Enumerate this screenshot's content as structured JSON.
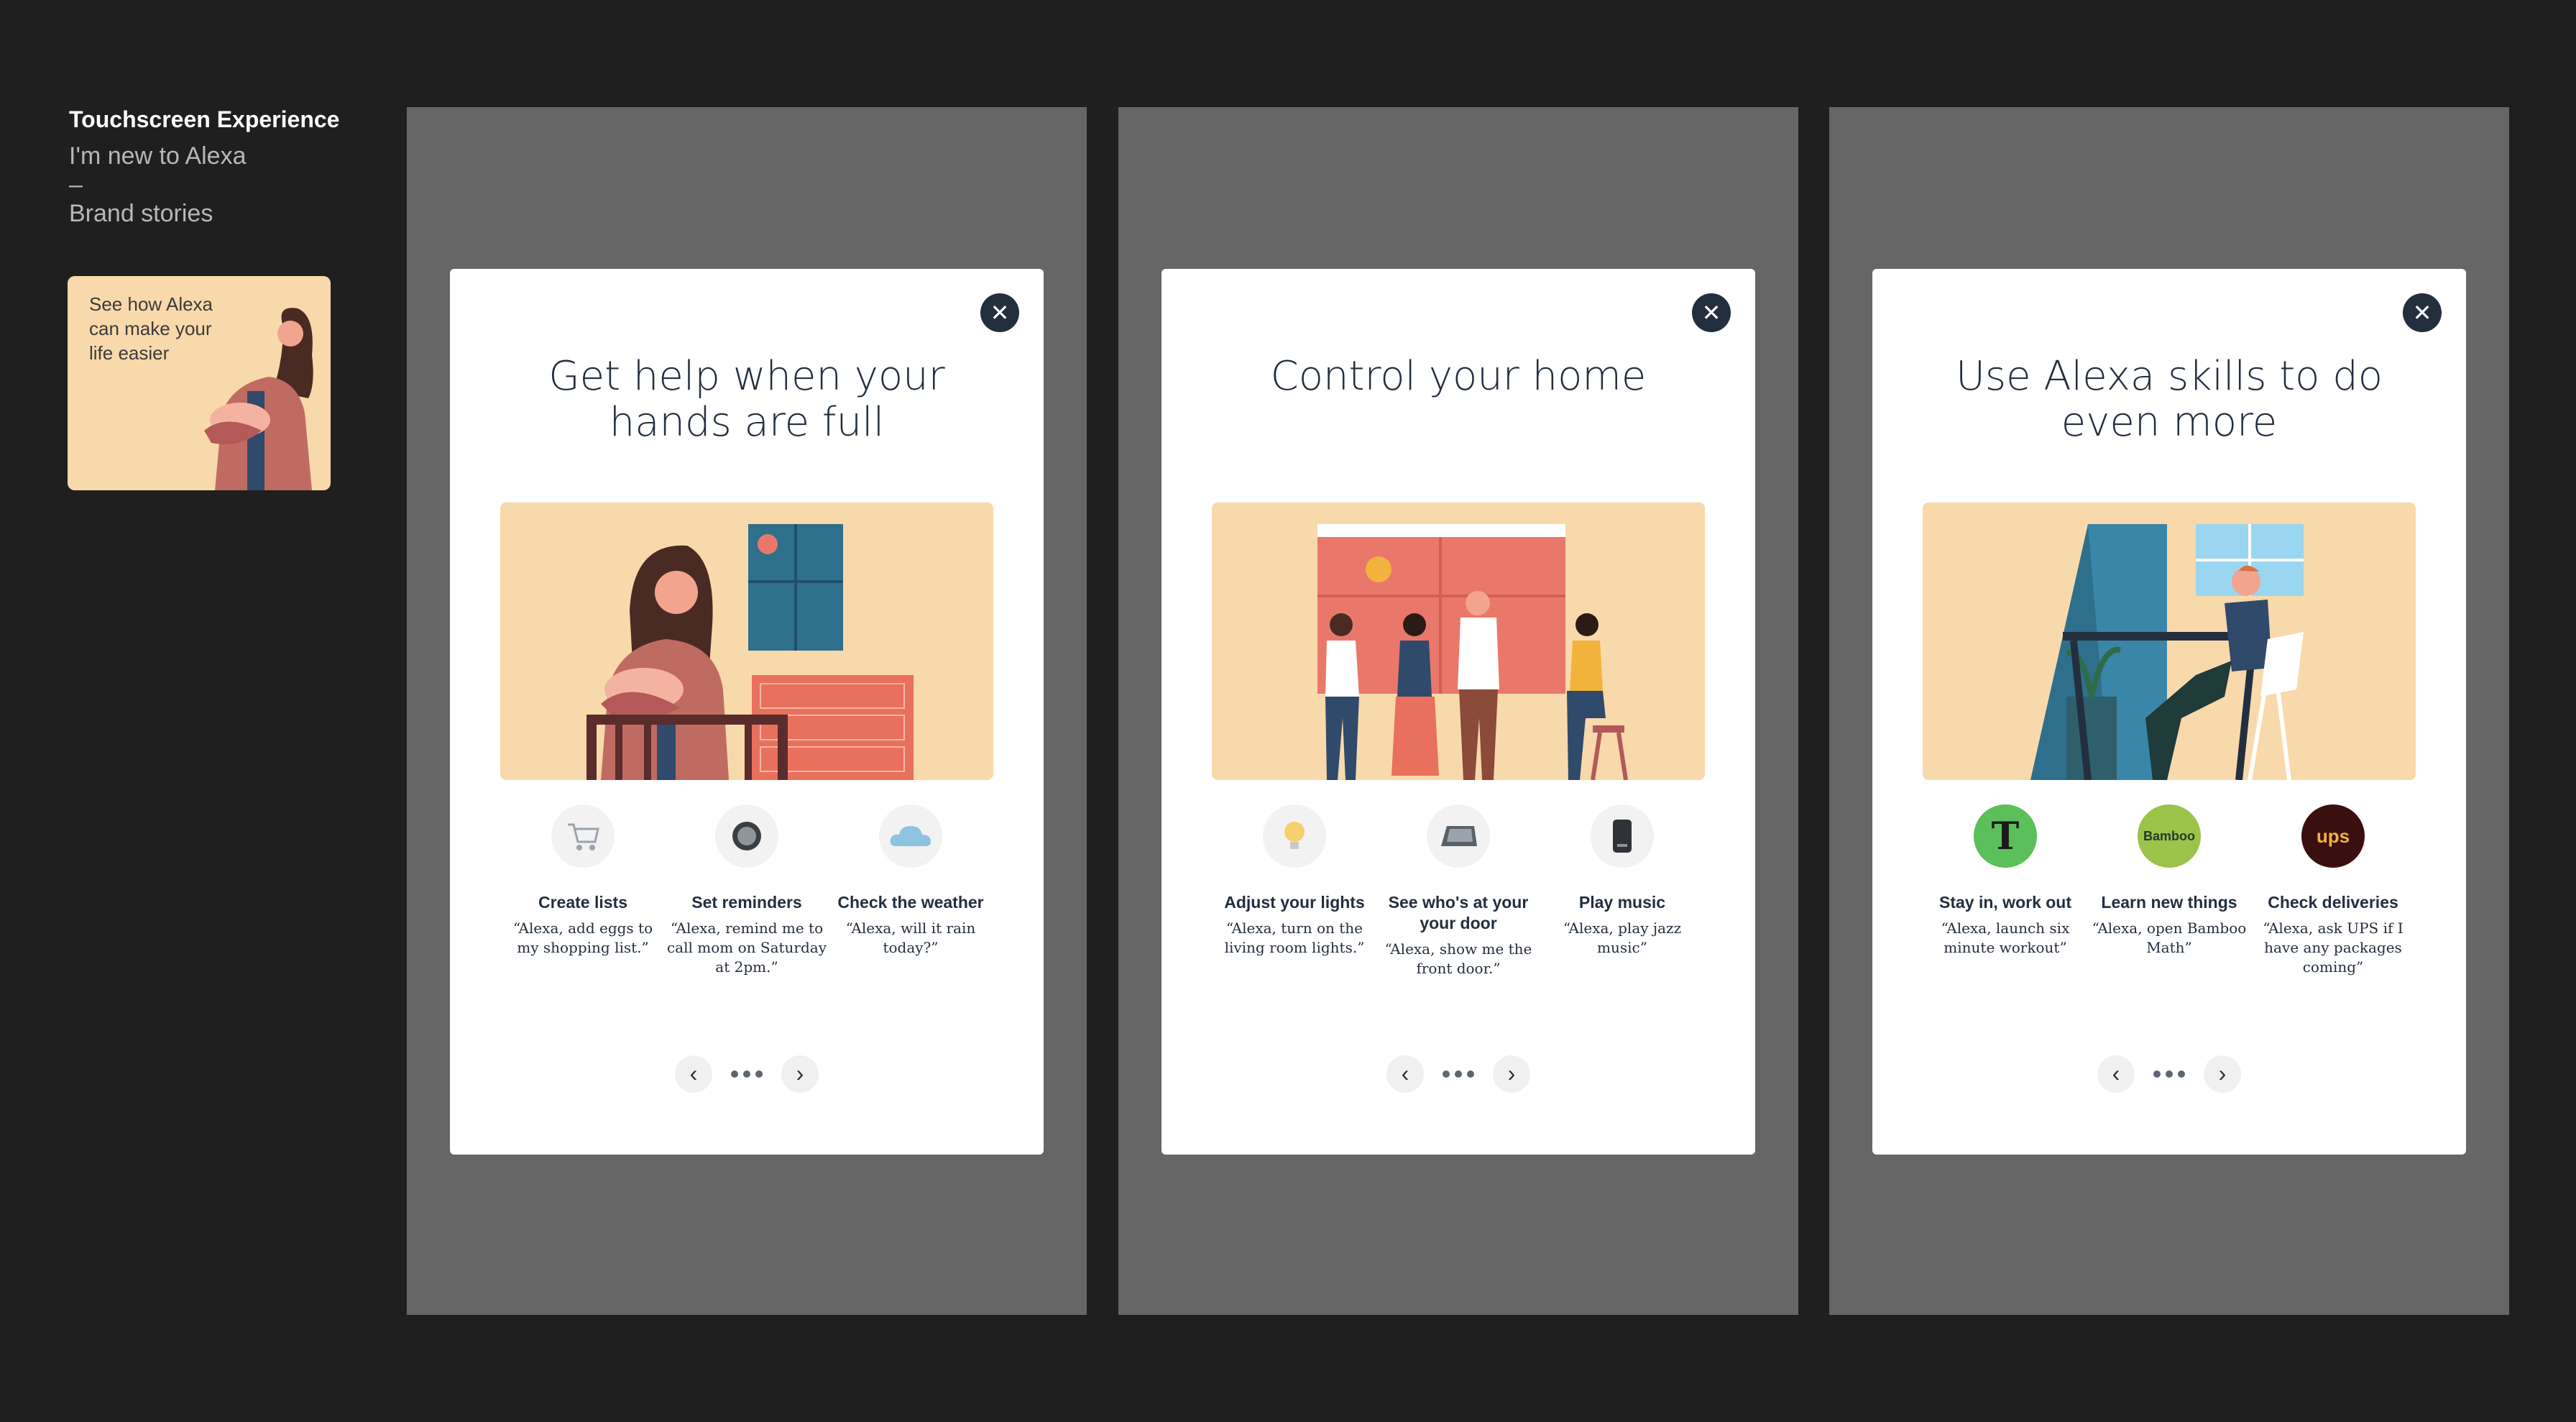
{
  "sidebar": {
    "title": "Touchscreen Experience",
    "subtitle": "I'm new to Alexa",
    "dash": "–",
    "section": "Brand stories",
    "thumb_text": "See how Alexa can make your life easier"
  },
  "cards": [
    {
      "title": "Get help when your hands are full",
      "features": [
        {
          "icon": "shopping-cart-icon",
          "label": "Create lists",
          "quote": "“Alexa, add eggs to my shopping list.”"
        },
        {
          "icon": "echo-dot-icon",
          "label": "Set reminders",
          "quote": "“Alexa, remind me to call mom on Saturday at 2pm.”"
        },
        {
          "icon": "cloud-icon",
          "label": "Check the weather",
          "quote": "“Alexa, will it rain today?”"
        }
      ]
    },
    {
      "title": "Control your home",
      "features": [
        {
          "icon": "light-bulb-icon",
          "label": "Adjust your lights",
          "quote": "“Alexa, turn on the living room lights.”"
        },
        {
          "icon": "camera-device-icon",
          "label": "See who's at your your door",
          "quote": "“Alexa, show me the front door.”"
        },
        {
          "icon": "speaker-icon",
          "label": "Play music",
          "quote": "“Alexa, play jazz music”"
        }
      ]
    },
    {
      "title": "Use Alexa skills to do even more",
      "features": [
        {
          "icon": "nyt-logo-icon",
          "label": "Stay in, work out",
          "quote": "“Alexa, launch six minute workout”"
        },
        {
          "icon": "bamboo-logo-icon",
          "label": "Learn new things",
          "quote": "“Alexa, open Bamboo Math”",
          "logo_text": "Bamboo"
        },
        {
          "icon": "ups-logo-icon",
          "label": "Check deliveries",
          "quote": "“Alexa, ask UPS if I have any packages coming”",
          "logo_text": "ups"
        }
      ]
    }
  ],
  "controls": {
    "close": "✕",
    "prev": "‹",
    "next": "›"
  },
  "colors": {
    "background": "#1f1f1f",
    "panel": "#666666",
    "navy": "#232f3e",
    "peach": "#f8d9ab"
  }
}
